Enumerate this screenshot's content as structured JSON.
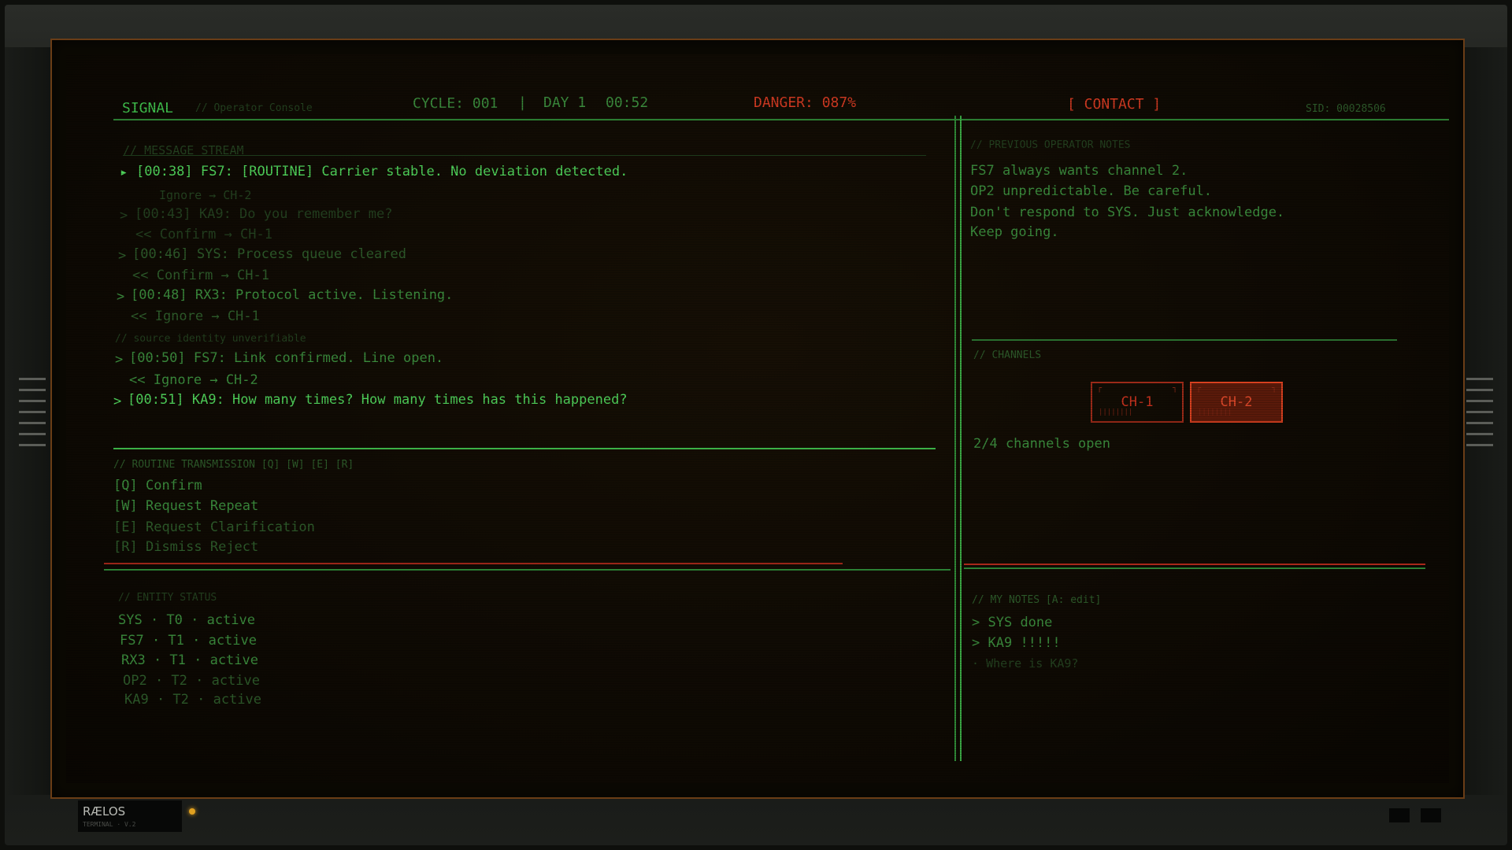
{
  "header": {
    "app_name": "SIGNAL",
    "app_sub": "// Operator Console",
    "cycle": "CYCLE: 001",
    "separator": "|",
    "day": "DAY 1",
    "clock": "00:52",
    "danger": "DANGER: 087%",
    "contact": "[ CONTACT ]",
    "sid": "SID: 00028506"
  },
  "stream": {
    "title": "// MESSAGE STREAM",
    "lines": [
      {
        "marker": "▸",
        "text": "[00:38] FS7: [ROUTINE] Carrier stable. No deviation detected.",
        "style": "bright"
      },
      {
        "marker": "",
        "text": "Ignore → CH-2",
        "style": "faint"
      },
      {
        "marker": ">",
        "text": "[00:43] KA9: Do you remember me?",
        "style": "faint"
      },
      {
        "marker": "",
        "text": "<< Confirm → CH-1",
        "style": "faint"
      },
      {
        "marker": ">",
        "text": "[00:46] SYS: Process queue cleared",
        "style": "dim"
      },
      {
        "marker": "",
        "text": "<< Confirm → CH-1",
        "style": "dim"
      },
      {
        "marker": ">",
        "text": "[00:48] RX3: Protocol active. Listening.",
        "style": "mid"
      },
      {
        "marker": "",
        "text": "<< Ignore → CH-1",
        "style": "dim"
      },
      {
        "marker": "",
        "text": "// source identity unverifiable",
        "style": "faint"
      },
      {
        "marker": ">",
        "text": "[00:50] FS7: Link confirmed. Line open.",
        "style": "mid"
      },
      {
        "marker": "",
        "text": "<< Ignore → CH-2",
        "style": "mid"
      },
      {
        "marker": ">",
        "text": "[00:51] KA9: How many times? How many times has this happened?",
        "style": "bright"
      }
    ]
  },
  "routine": {
    "title": "// ROUTINE TRANSMISSION   [Q] [W] [E] [R]",
    "options": [
      {
        "key": "[Q]",
        "label": "Confirm",
        "style": "mid"
      },
      {
        "key": "[W]",
        "label": "Request Repeat",
        "style": "mid"
      },
      {
        "key": "[E]",
        "label": "Request Clarification",
        "style": "dim"
      },
      {
        "key": "[R]",
        "label": "Dismiss Reject",
        "style": "dim"
      }
    ]
  },
  "entity": {
    "title": "// ENTITY STATUS",
    "rows": [
      {
        "text": "SYS  · T0 · active",
        "style": "mid"
      },
      {
        "text": "FS7  · T1 · active",
        "style": "mid"
      },
      {
        "text": "RX3  · T1 · active",
        "style": "mid"
      },
      {
        "text": "OP2  · T2 · active",
        "style": "dim"
      },
      {
        "text": "KA9  · T2 · active",
        "style": "dim"
      }
    ]
  },
  "notes": {
    "title": "// PREVIOUS OPERATOR NOTES",
    "lines": [
      "FS7 always wants channel 2.",
      "OP2 unpredictable. Be careful.",
      "Don't respond to SYS. Just acknowledge.",
      "Keep going."
    ]
  },
  "channels": {
    "title": "// CHANNELS",
    "items": [
      {
        "label": "CH-1",
        "active": false
      },
      {
        "label": "CH-2",
        "active": true
      }
    ],
    "status": "2/4 channels open"
  },
  "my_notes": {
    "title": "// MY NOTES  [A: edit]",
    "items": [
      {
        "marker": ">",
        "text": "SYS done",
        "style": "mid"
      },
      {
        "marker": ">",
        "text": "KA9 !!!!!",
        "style": "mid"
      },
      {
        "marker": "·",
        "text": "Where is KA9?",
        "style": "faint"
      }
    ]
  },
  "taskbar": {
    "os_name": "RÆLOS",
    "os_sub": "TERMINAL · V.2"
  },
  "colors": {
    "terminal_green": "#3fae4a",
    "danger_red": "#d23a22",
    "frame_amber": "#6a3d16"
  }
}
